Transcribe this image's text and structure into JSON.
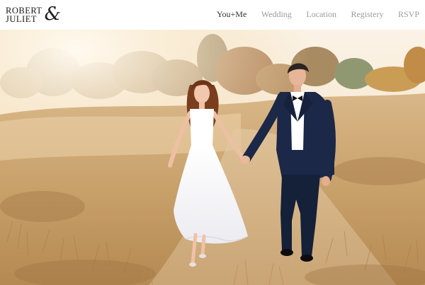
{
  "brand": {
    "name_line1": "ROBERT",
    "name_line2": "JULIET",
    "ampersand": "&"
  },
  "nav": {
    "items": [
      {
        "label": "You+Me",
        "active": true
      },
      {
        "label": "Wedding",
        "active": false
      },
      {
        "label": "Location",
        "active": false
      },
      {
        "label": "Registery",
        "active": false
      },
      {
        "label": "RSVP",
        "active": false
      }
    ]
  },
  "hero": {
    "image_subject": "couple-walking-in-field-photo"
  },
  "colors": {
    "nav_active": "#333333",
    "nav_inactive": "#9b9b9b",
    "brand_text": "#1a1a1a",
    "header_bg": "#ffffff"
  }
}
